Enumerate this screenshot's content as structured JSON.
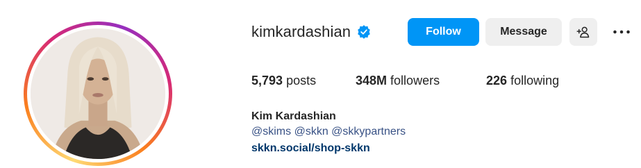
{
  "profile": {
    "username": "kimkardashian",
    "verified": true,
    "full_name": "Kim Kardashian",
    "bio_mentions": [
      "@skims",
      "@skkn",
      "@skkypartners"
    ],
    "website": "skkn.social/shop-skkn"
  },
  "actions": {
    "follow_label": "Follow",
    "message_label": "Message"
  },
  "stats": {
    "posts_count": "5,793",
    "posts_label": "posts",
    "followers_count": "348M",
    "followers_label": "followers",
    "following_count": "226",
    "following_label": "following"
  },
  "icons": {
    "verified": "verified-badge-icon",
    "add_user": "add-user-icon",
    "more": "more-options-icon"
  },
  "colors": {
    "follow_button": "#0095f6",
    "secondary_button": "#efefef",
    "verified_badge": "#0095f6",
    "link_text": "#00376b"
  }
}
